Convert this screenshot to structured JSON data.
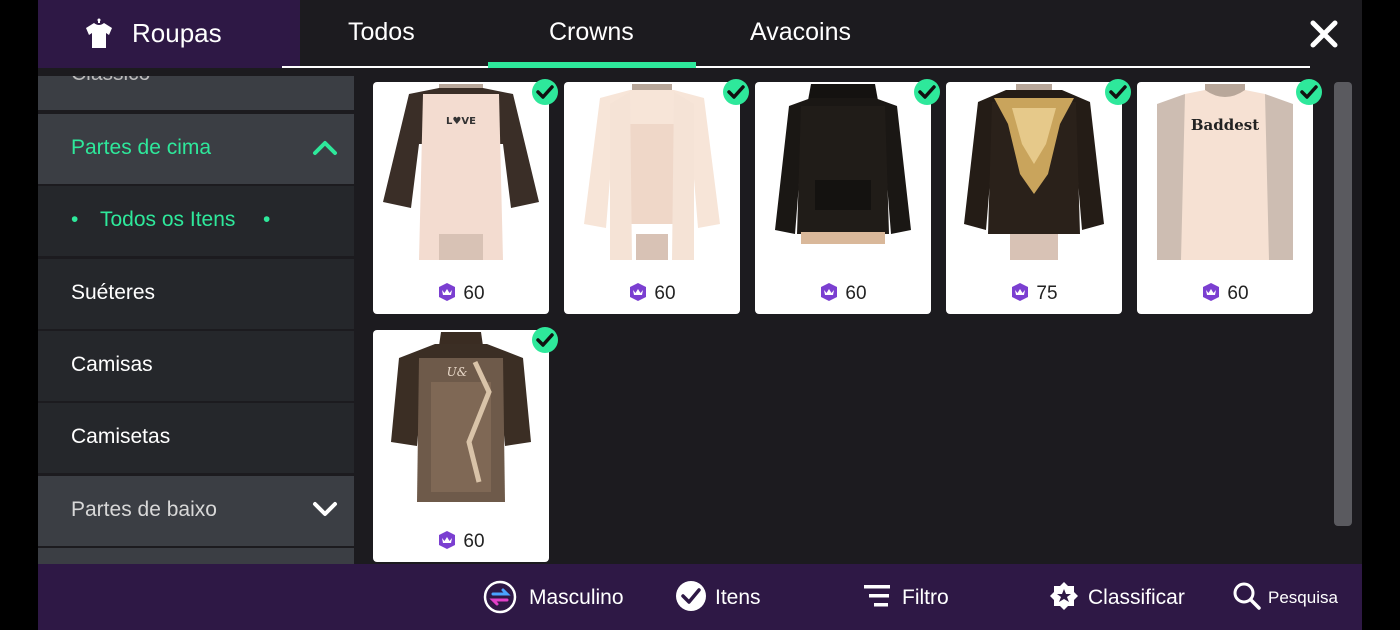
{
  "header": {
    "title": "Roupas",
    "tabs": [
      {
        "label": "Todos",
        "active": false
      },
      {
        "label": "Crowns",
        "active": true
      },
      {
        "label": "Avacoins",
        "active": false
      }
    ],
    "accent": "#2ee89b"
  },
  "sidebar": {
    "items": [
      {
        "label": "Clássico"
      },
      {
        "label": "Partes de cima",
        "expanded": true
      },
      {
        "label": "Todos os Itens",
        "selected": true
      },
      {
        "label": "Suéteres"
      },
      {
        "label": "Camisas"
      },
      {
        "label": "Camisetas"
      },
      {
        "label": "Partes de baixo",
        "expanded": false
      }
    ]
  },
  "items": [
    {
      "name": "oversized-love-tee-with-black-shirt",
      "price": "60",
      "owned": true
    },
    {
      "name": "cream-shirt-over-tank",
      "price": "60",
      "owned": true
    },
    {
      "name": "black-hoodie",
      "price": "60",
      "owned": true
    },
    {
      "name": "black-gold-baroque-sweater",
      "price": "75",
      "owned": true
    },
    {
      "name": "baddest-tank",
      "price": "60",
      "owned": true
    },
    {
      "name": "sheer-brown-shirt",
      "price": "60",
      "owned": true
    }
  ],
  "footer": {
    "gender": "Masculino",
    "items": "Itens",
    "filter": "Filtro",
    "sort": "Classificar",
    "search": "Pesquisa"
  }
}
